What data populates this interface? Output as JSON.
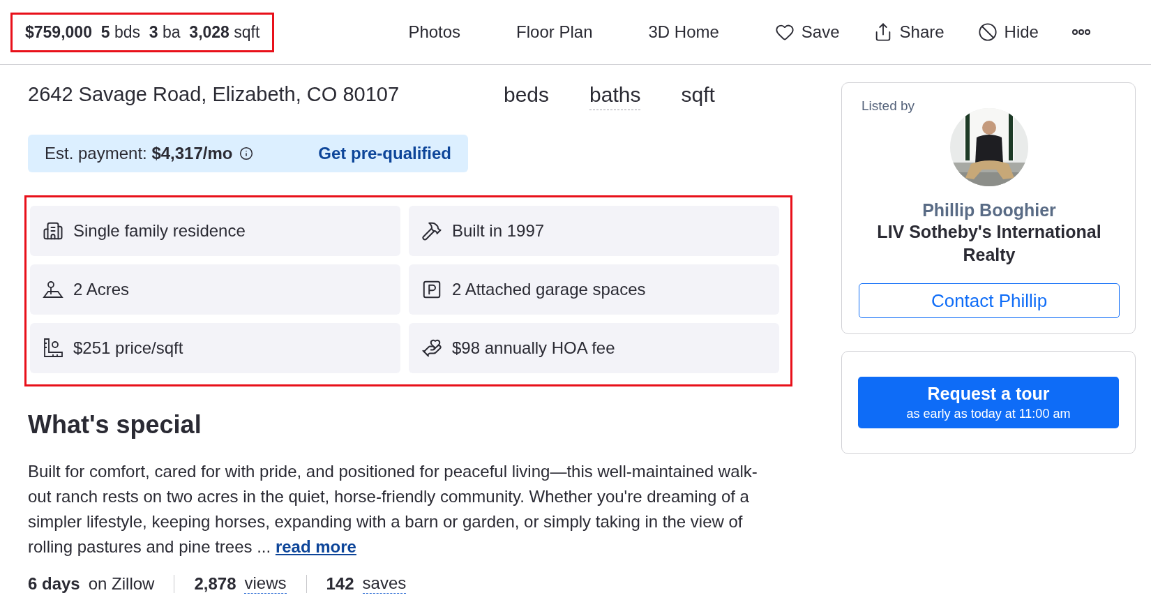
{
  "header": {
    "summary": "**$759,000**  **5** bds  **3** ba  **3,028** sqft",
    "summary_highlighted": true,
    "nav": [
      "Photos",
      "Floor Plan",
      "3D Home"
    ],
    "actions": [
      {
        "kind": "save",
        "label": "Save"
      },
      {
        "kind": "share",
        "label": "Share"
      },
      {
        "kind": "hide",
        "label": "Hide"
      },
      {
        "kind": "more"
      }
    ]
  },
  "address": "2642 Savage Road, Elizabeth, CO 80107",
  "quick_stats": [
    {
      "label": "beds",
      "dotted": false
    },
    {
      "label": "baths",
      "dotted": true
    },
    {
      "label": "sqft",
      "dotted": false
    }
  ],
  "payment": {
    "text": "Est. payment: **$4,317/mo**",
    "link": "Get pre-qualified"
  },
  "facts_highlighted": true,
  "facts": [
    {
      "kind": "building",
      "text": "Single family residence"
    },
    {
      "kind": "hammer",
      "text": "Built in 1997"
    },
    {
      "kind": "land",
      "text": "2 Acres"
    },
    {
      "kind": "parking",
      "text": "2 Attached garage spaces"
    },
    {
      "kind": "ruler",
      "text": "$251 price/sqft"
    },
    {
      "kind": "hoa",
      "text": "$98 annually HOA fee"
    }
  ],
  "special": {
    "title": "What's special",
    "body": "Built for comfort, cared for with pride, and positioned for peaceful living—this well-maintained walk-out ranch rests on two acres in the quiet, horse-friendly community. Whether you're dreaming of a simpler lifestyle, keeping horses, expanding with a barn or garden, or simply taking in the view of rolling pastures and pine trees ...",
    "link": "read more"
  },
  "activity": [
    {
      "value": "6 days",
      "label": "on Zillow",
      "dotted": false
    },
    {
      "value": "2,878",
      "label": "views",
      "dotted": true
    },
    {
      "value": "142",
      "label": "saves",
      "dotted": true
    }
  ],
  "agent": {
    "caption": "Listed by",
    "name": "Phillip Booghier",
    "agency": "LIV Sotheby's International Realty",
    "button": "Contact Phillip"
  },
  "tour": {
    "title": "Request a tour",
    "subtitle": "as early as today at 11:00 am"
  }
}
